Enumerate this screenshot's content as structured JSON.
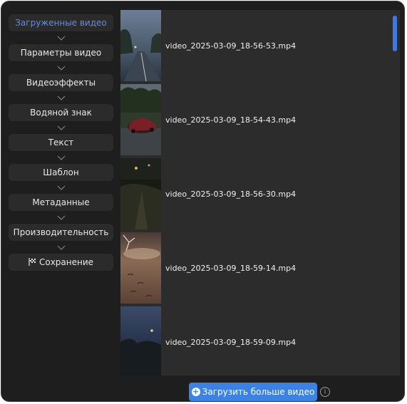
{
  "steps": [
    {
      "label": "Загруженные видео",
      "active": true
    },
    {
      "label": "Параметры видео"
    },
    {
      "label": "Видеоэффекты"
    },
    {
      "label": "Водяной знак"
    },
    {
      "label": "Текст"
    },
    {
      "label": "Шаблон"
    },
    {
      "label": "Метаданные"
    },
    {
      "label": "Производительность"
    },
    {
      "label": "Сохранение",
      "icon": "checkered-flag-icon"
    }
  ],
  "videos": [
    {
      "filename": "video_2025-03-09_18-56-53.mp4"
    },
    {
      "filename": "video_2025-03-09_18-54-43.mp4"
    },
    {
      "filename": "video_2025-03-09_18-56-30.mp4"
    },
    {
      "filename": "video_2025-03-09_18-59-14.mp4"
    },
    {
      "filename": "video_2025-03-09_18-59-09.mp4"
    }
  ],
  "footer": {
    "upload_label": "Загрузить больше видео",
    "upload_icon": "plus-circle-icon",
    "info_icon": "info-icon"
  },
  "colors": {
    "accent": "#3c82e3",
    "active_step": "#5b8fe6",
    "background": "#1e1e1e",
    "panel": "#2c2c2c"
  }
}
